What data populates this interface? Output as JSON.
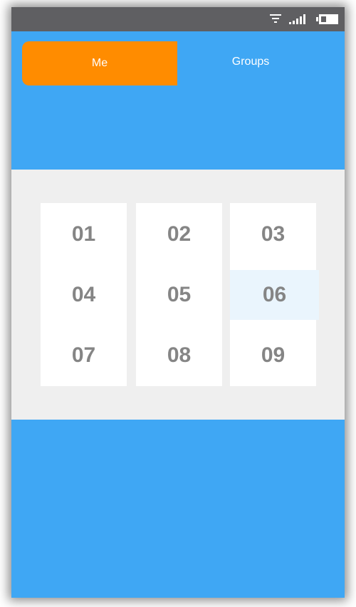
{
  "status_bar": {
    "icons": [
      "wifi-icon",
      "signal-icon",
      "battery-icon"
    ]
  },
  "tabs": {
    "me_label": "Me",
    "groups_label": "Groups",
    "active": "Me"
  },
  "grid": {
    "cells": [
      "01",
      "02",
      "03",
      "04",
      "05",
      "06",
      "07",
      "08",
      "09"
    ],
    "selected": "06"
  },
  "colors": {
    "background": "#3fa7f4",
    "status_bar": "#5f5f62",
    "active_tab": "#ff8c00",
    "panel": "#efefef",
    "cell_text": "#858585",
    "selected_cell": "#eaf5fd"
  }
}
